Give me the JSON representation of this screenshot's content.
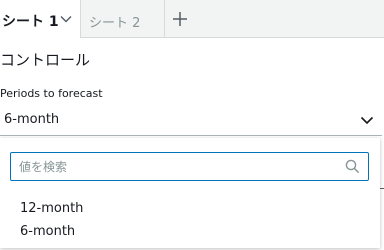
{
  "sheet_tabs": {
    "active": {
      "label": "シート 1"
    },
    "inactive": {
      "label": "シート 2"
    }
  },
  "control": {
    "section_title": "コントロール",
    "field_label": "Periods to forecast",
    "selected_value": "6-month"
  },
  "dropdown": {
    "search_placeholder": "値を検索",
    "options": [
      {
        "label": "12-month"
      },
      {
        "label": "6-month"
      }
    ]
  },
  "icons": {
    "tab_menu": "chevron-down-icon",
    "add_sheet": "plus-icon",
    "select_toggle": "chevron-down-icon",
    "search": "search-icon"
  },
  "colors": {
    "accent": "#0073bb",
    "tabbar_bg": "#f2f3f3",
    "muted_text": "#879596"
  }
}
